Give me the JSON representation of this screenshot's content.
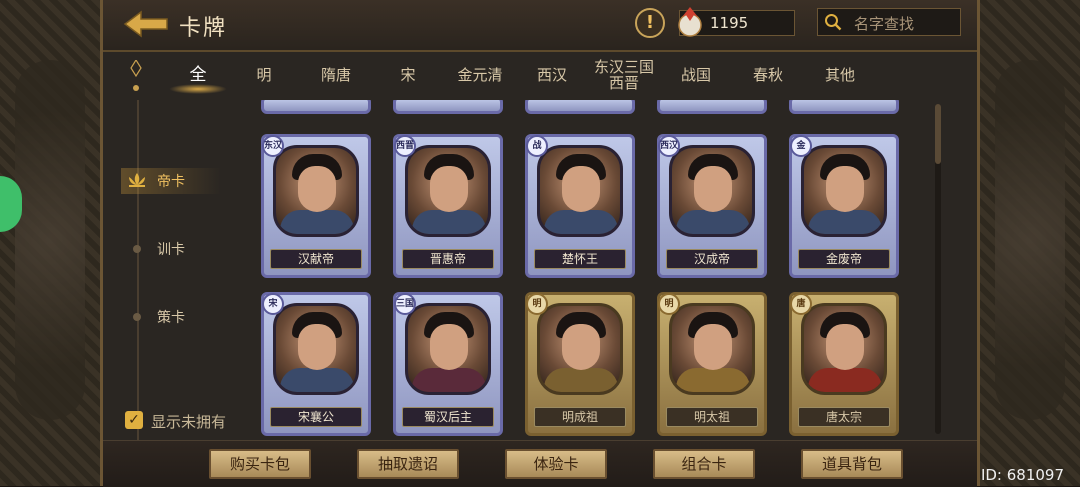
{
  "header": {
    "title": "卡牌",
    "warning_icon": "exclamation-icon",
    "coin_value": "1195",
    "search_placeholder": "名字查找"
  },
  "tabs": [
    "全",
    "明",
    "隋唐",
    "宋",
    "金元清",
    "西汉",
    "东汉三国西晋",
    "战国",
    "春秋",
    "其他"
  ],
  "active_tab": "全",
  "left_nav": {
    "items": [
      {
        "label": "帝卡",
        "active": true
      },
      {
        "label": "训卡",
        "active": false
      },
      {
        "label": "策卡",
        "active": false
      }
    ],
    "show_unowned_label": "显示未拥有",
    "show_unowned_checked": true
  },
  "cards_row1": [
    {
      "name": "汉献帝",
      "badge": "东汉",
      "owned": true
    },
    {
      "name": "晋惠帝",
      "badge": "西晋",
      "owned": true
    },
    {
      "name": "楚怀王",
      "badge": "战",
      "owned": true
    },
    {
      "name": "汉成帝",
      "badge": "西汉",
      "owned": true
    },
    {
      "name": "金废帝",
      "badge": "金",
      "owned": true
    }
  ],
  "cards_row2": [
    {
      "name": "宋襄公",
      "badge": "宋",
      "owned": true
    },
    {
      "name": "蜀汉后主",
      "badge": "三国",
      "owned": true
    },
    {
      "name": "明成祖",
      "badge": "明",
      "owned": false
    },
    {
      "name": "明太祖",
      "badge": "明",
      "owned": false
    },
    {
      "name": "唐太宗",
      "badge": "唐",
      "owned": false
    }
  ],
  "footer": {
    "buttons": [
      "购买卡包",
      "抽取遗诏",
      "体验卡",
      "组合卡",
      "道具背包"
    ],
    "id_label": "ID: 681097"
  },
  "colors": {
    "accent_gold": "#e0b040",
    "owned_card_frame": "#6a6aa8",
    "unowned_card_frame": "#7a6030"
  }
}
